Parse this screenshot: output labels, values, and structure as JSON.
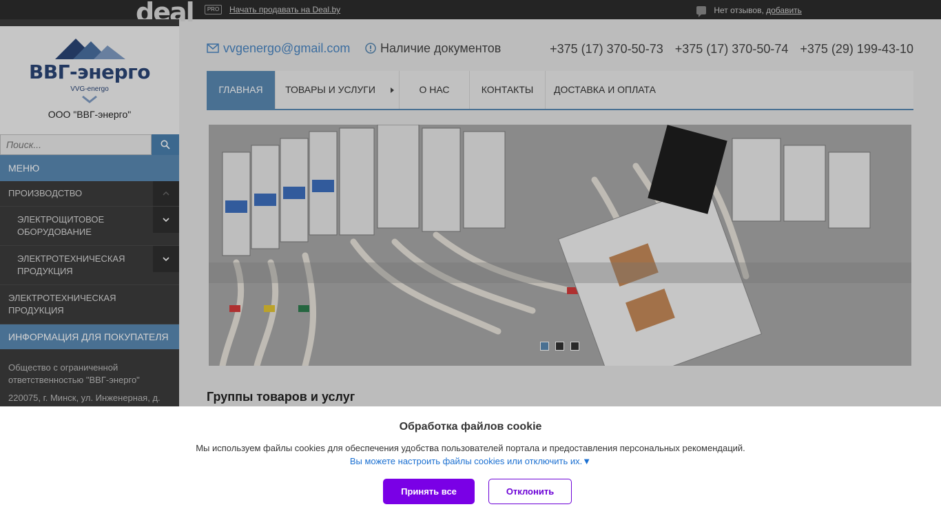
{
  "dealbar": {
    "logo": "deal",
    "pro_badge": "PRO",
    "sell_link": "Начать продавать на Deal.by",
    "reviews_text": "Нет отзывов,",
    "reviews_link": "добавить"
  },
  "brand": {
    "name": "ВВГ-энерго",
    "sub": "VVG-energo",
    "company": "ООО \"ВВГ-энерго\""
  },
  "search": {
    "placeholder": "Поиск..."
  },
  "sidebar": {
    "menu_head": "Меню",
    "items": [
      {
        "label": "Производство"
      },
      {
        "label": "Электрощитовое оборудование"
      },
      {
        "label": "Электротехническая продукция"
      },
      {
        "label": "Электротехническая продукция"
      }
    ],
    "info_head": "Информация для покупателя",
    "info_lines": [
      "Общество с ограниченной ответственностью \"ВВГ-энерго\"",
      "220075, г. Минск, ул. Инженерная, д."
    ]
  },
  "contacts": {
    "email": "vvgenergo@gmail.com",
    "docs": "Наличие документов",
    "phones": [
      "+375 (17) 370-50-73",
      "+375 (17) 370-50-74",
      "+375 (29) 199-43-10"
    ]
  },
  "nav": {
    "items": [
      "Главная",
      "Товары и услуги",
      "О нас",
      "Контакты",
      "Доставка и оплата"
    ]
  },
  "slider": {
    "slide_count": 3,
    "active_slide": 1
  },
  "main": {
    "section_title": "Группы товаров и услуг"
  },
  "cookie": {
    "title": "Обработка файлов cookie",
    "text": "Мы используем файлы cookies для обеспечения удобства пользователей портала и предоставления персональных рекомендаций.",
    "link": "Вы можете настроить файлы cookies или отключить их.▼",
    "accept": "Принять все",
    "decline": "Отклонить"
  },
  "colors": {
    "accent": "#5a89b3",
    "brand_navy": "#2a4576",
    "cookie_purple": "#7a00e6",
    "sidebar_dark": "#3c3c3c"
  }
}
